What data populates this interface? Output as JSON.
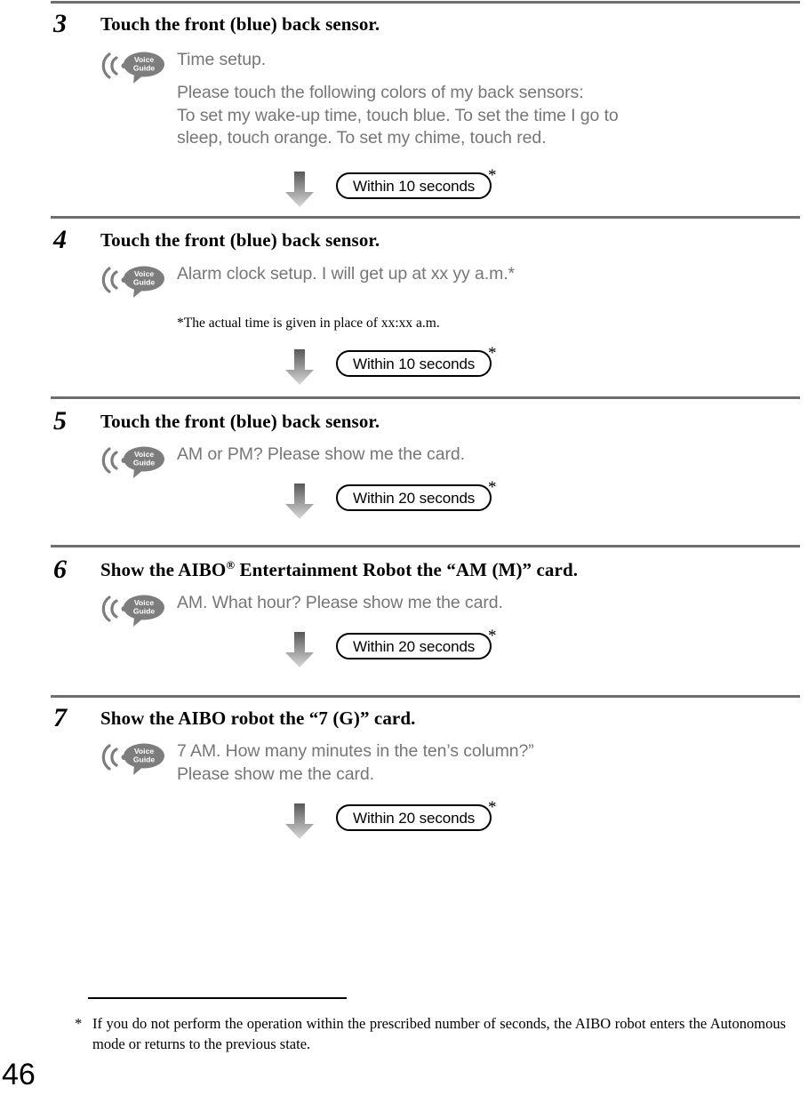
{
  "document": {
    "page_number": "46",
    "voice_guide_icon_label_line1": "Voice",
    "voice_guide_icon_label_line2": "Guide"
  },
  "steps": [
    {
      "number": "3",
      "title_prefix": "Touch the front (blue) back sensor.",
      "title_sup": "",
      "title_suffix": "",
      "voice_text": "Time setup.",
      "voice_text_2": "Please touch the following colors of my back sensors:\nTo set my wake-up time, touch blue. To set the time I go to\nsleep, touch orange. To set my chime, touch red.",
      "note": "",
      "timing_label": "Within 10 seconds",
      "timing_star": "*"
    },
    {
      "number": "4",
      "title_prefix": "Touch the front (blue) back sensor.",
      "title_sup": "",
      "title_suffix": "",
      "voice_text": "Alarm clock setup. I will get up at xx yy a.m.*",
      "voice_text_2": "",
      "note": "*The actual time is given in place of xx:xx a.m.",
      "timing_label": "Within 10 seconds",
      "timing_star": "*"
    },
    {
      "number": "5",
      "title_prefix": "Touch the front (blue) back sensor.",
      "title_sup": "",
      "title_suffix": "",
      "voice_text": "AM or PM? Please show me the card.",
      "voice_text_2": "",
      "note": "",
      "timing_label": "Within 20 seconds",
      "timing_star": "*"
    },
    {
      "number": "6",
      "title_prefix": "Show the AIBO",
      "title_sup": "®",
      "title_suffix": " Entertainment Robot the “AM (M)” card.",
      "voice_text": "AM. What hour? Please show me the card.",
      "voice_text_2": "",
      "note": "",
      "timing_label": "Within 20 seconds",
      "timing_star": "*"
    },
    {
      "number": "7",
      "title_prefix": "Show the AIBO robot the “7 (G)” card.",
      "title_sup": "",
      "title_suffix": "",
      "voice_text": "7 AM. How many minutes in the ten’s column?”\nPlease show me the card.",
      "voice_text_2": "",
      "note": "",
      "timing_label": "Within 20 seconds",
      "timing_star": "*"
    }
  ],
  "footnote": {
    "marker": "*",
    "text": "If you do not perform the operation within the prescribed number of seconds, the AIBO robot enters the Autonomous mode or returns to the previous state."
  },
  "colors": {
    "rule": "#6e6e6e",
    "voice_text": "#767676",
    "icon_gray": "#7d7d7d",
    "arrow_top": "#595959",
    "arrow_bottom": "#d4d4d4"
  }
}
